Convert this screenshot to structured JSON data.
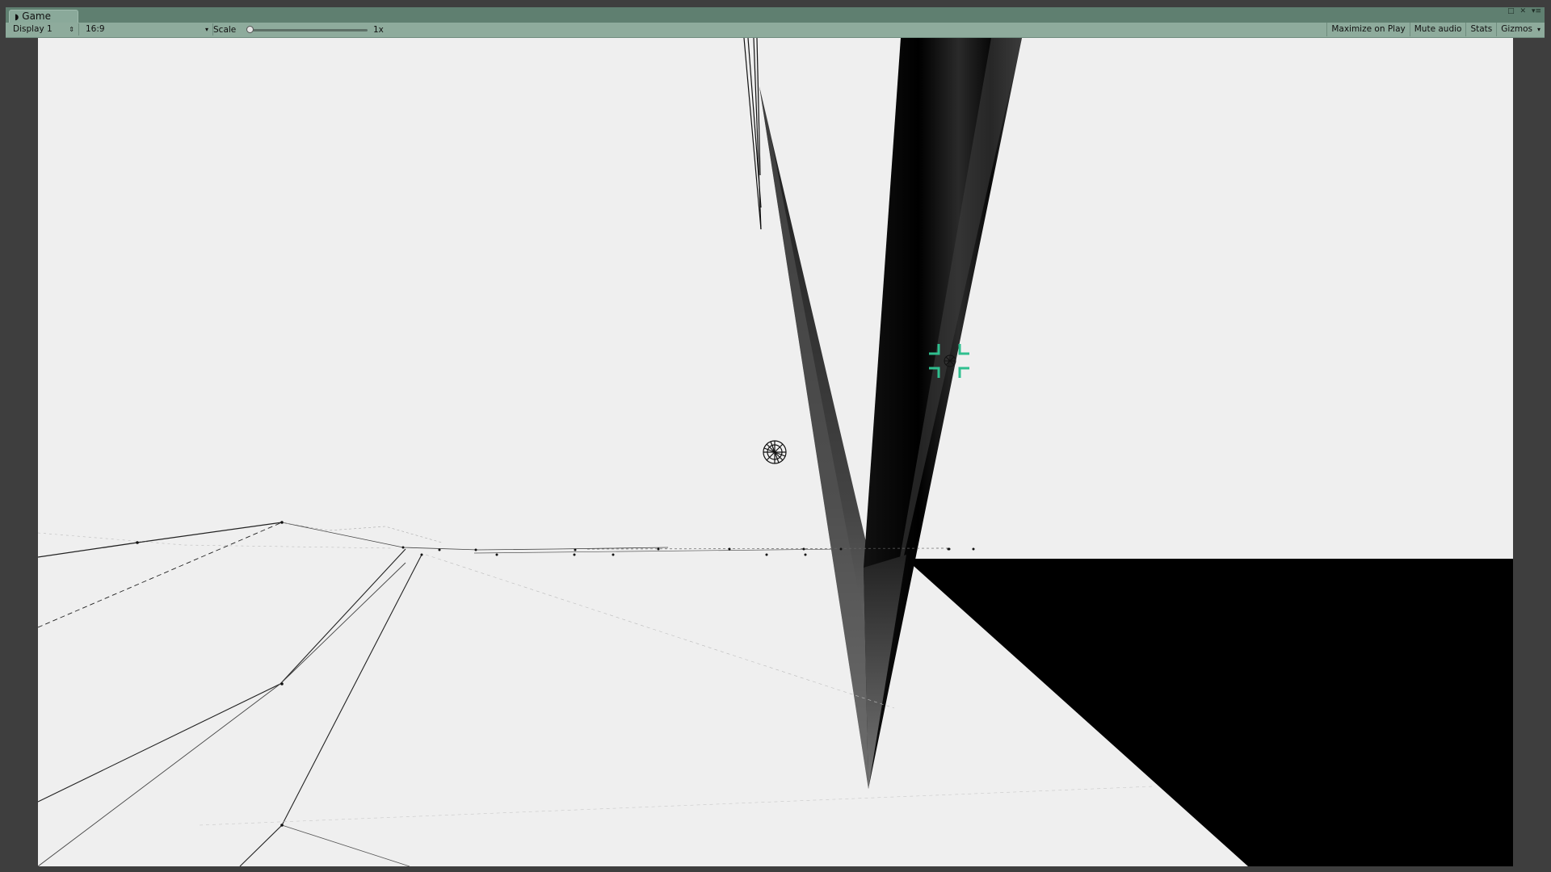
{
  "window": {
    "tab_label": "Game",
    "tab_icon": "pacman-game-icon",
    "controls": [
      "□",
      "✕",
      "▾≡"
    ]
  },
  "toolbar": {
    "display": "Display 1",
    "aspect": "16:9",
    "scale_label": "Scale",
    "scale_value": "1x",
    "scale_level": 0,
    "buttons": {
      "maximize": "Maximize on Play",
      "mute": "Mute audio",
      "stats": "Stats",
      "gizmos": "Gizmos"
    }
  },
  "scene": {
    "background": "#efefef",
    "accent": "#2fbf8f",
    "solid": "#000000"
  }
}
